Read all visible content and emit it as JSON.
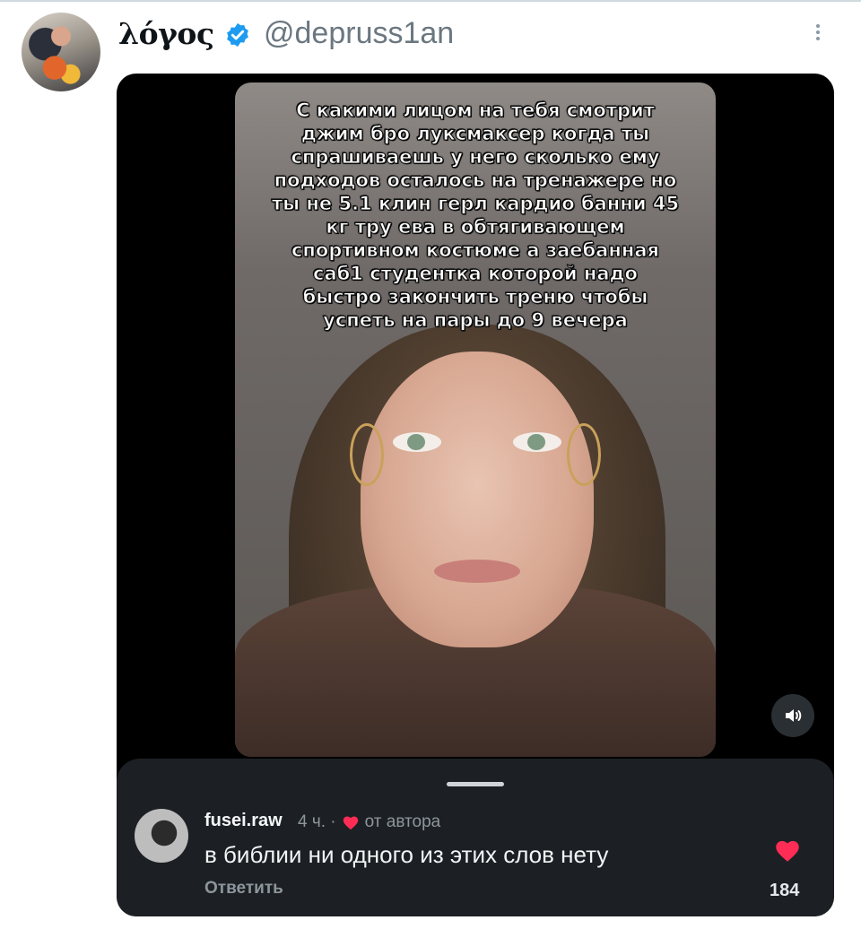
{
  "post": {
    "display_name": "λόγος",
    "handle": "@depruss1an",
    "icons": {
      "verified": "verified-badge-icon",
      "more": "more-vertical-icon"
    }
  },
  "media": {
    "caption": "С какими лицом на тебя смотрит джим бро луксмаксер когда ты спрашиваешь у него сколько ему подходов осталось на тренажере но ты не 5.1 клин герл кардио банни 45 кг тру ева в обтягивающем спортивном костюме а заебанная саб1 студентка которой надо быстро закончить треню чтобы успеть на пары до 9 вечера",
    "volume_icon": "volume-icon"
  },
  "comment": {
    "username": "fusei.raw",
    "time": "4 ч. ·",
    "author_liked": "от автора",
    "text": "в библии ни одного из этих слов нету",
    "reply_label": "Ответить",
    "like_count": "184",
    "heart_color": "#ff2d55"
  },
  "colors": {
    "verified_blue": "#1d9bf0",
    "handle_gray": "#6b7780"
  }
}
